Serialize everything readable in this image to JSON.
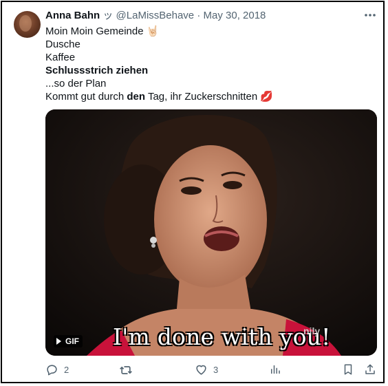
{
  "tweet": {
    "author_name": "Anna Bahn",
    "author_emoji": "ッ",
    "handle": "@LaMissBehave",
    "separator": "·",
    "date": "May 30, 2018",
    "lines": {
      "l1": "Moin Moin Gemeinde",
      "l1_emoji": "🤘🏻",
      "l2": "Dusche",
      "l3": "Kaffee",
      "l4": "Schlussstrich ziehen",
      "l5": "...so der Plan",
      "l6_pre": "Kommt gut durch ",
      "l6_bold": "den",
      "l6_post": " Tag, ihr Zuckerschnitten",
      "l6_emoji": "💋"
    }
  },
  "media": {
    "caption": "I'm done with you!",
    "watermark": "nily",
    "badge_label": "GIF"
  },
  "actions": {
    "replies": "2",
    "likes": "3"
  },
  "icons": [
    "more-icon",
    "play-icon",
    "reply-icon",
    "retweet-icon",
    "like-icon",
    "views-icon",
    "bookmark-icon",
    "share-icon"
  ]
}
